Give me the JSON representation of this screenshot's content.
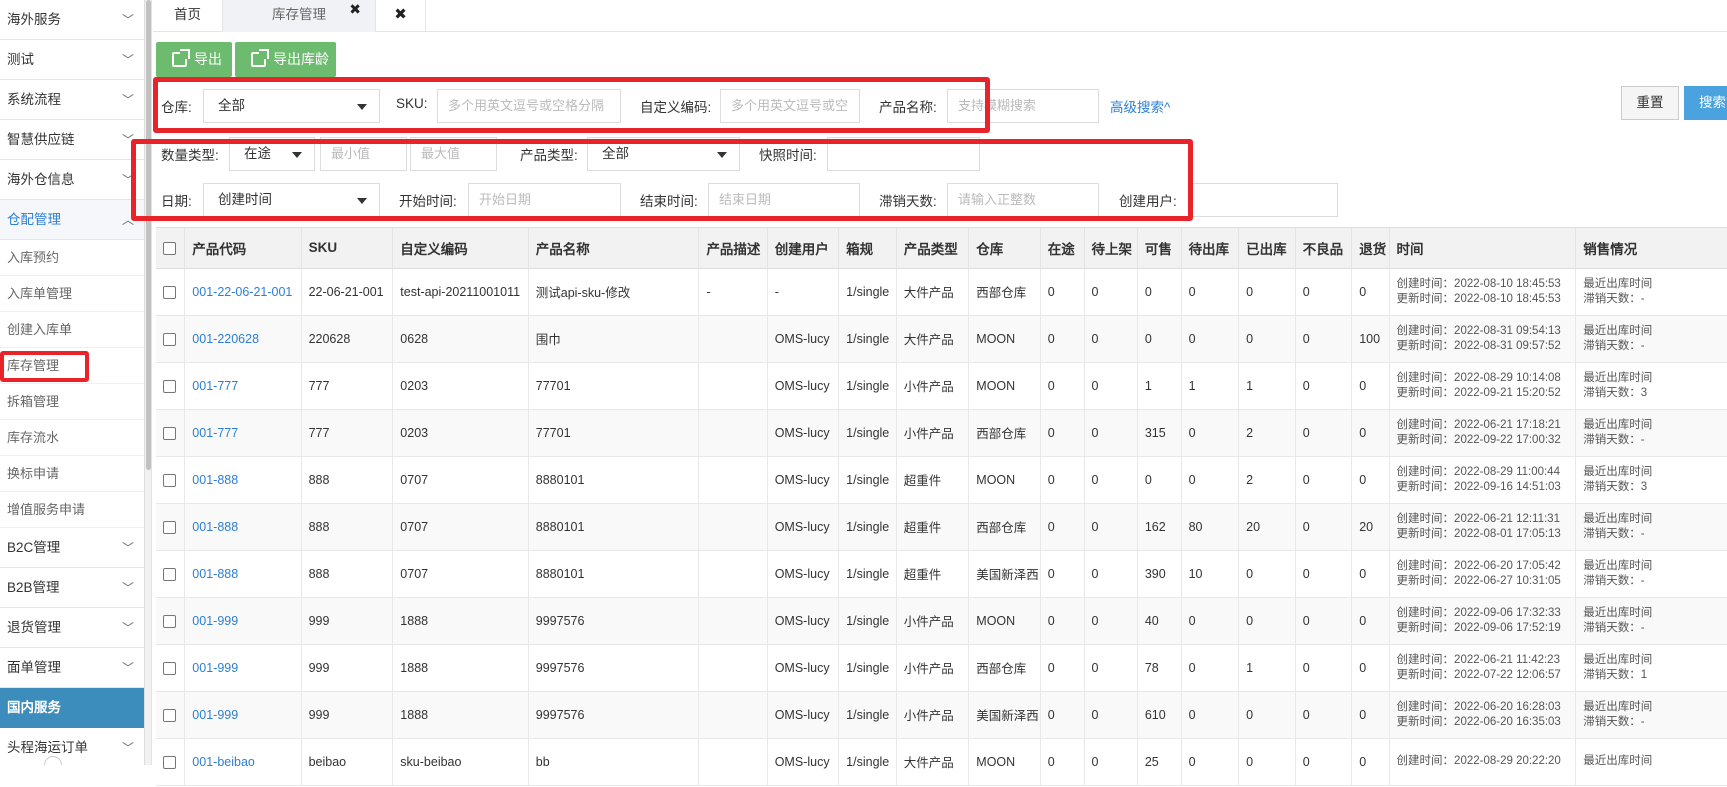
{
  "sidebar": {
    "items_top": [
      {
        "label": "海外服务"
      },
      {
        "label": "测试"
      },
      {
        "label": "系统流程"
      },
      {
        "label": "智慧供应链"
      },
      {
        "label": "海外仓信息"
      }
    ],
    "open_group": {
      "label": "仓配管理"
    },
    "sub_items": [
      {
        "label": "入库预约"
      },
      {
        "label": "入库单管理"
      },
      {
        "label": "创建入库单"
      },
      {
        "label": "库存管理"
      },
      {
        "label": "拆箱管理"
      },
      {
        "label": "库存流水"
      },
      {
        "label": "换标申请"
      },
      {
        "label": "增值服务申请"
      }
    ],
    "items_bottom": [
      {
        "label": "B2C管理"
      },
      {
        "label": "B2B管理"
      },
      {
        "label": "退货管理"
      },
      {
        "label": "面单管理"
      }
    ],
    "dark_item": {
      "label": "国内服务"
    },
    "last_item": {
      "label": "头程海运订单"
    }
  },
  "tabs": {
    "home": "首页",
    "active": "库存管理",
    "close_symbol": "✖",
    "active_close": "✖"
  },
  "toolbar": {
    "export": "导出",
    "export_age": "导出库龄"
  },
  "filters": {
    "warehouse_label": "仓库:",
    "warehouse_value": "全部",
    "sku_label": "SKU:",
    "sku_placeholder": "多个用英文逗号或空格分隔",
    "custom_code_label": "自定义编码:",
    "custom_code_placeholder": "多个用英文逗号或空",
    "product_name_label": "产品名称:",
    "product_name_placeholder": "支持模糊搜索",
    "advanced_search": "高级搜索^",
    "reset": "重置",
    "search": "搜索",
    "qty_type_label": "数量类型:",
    "qty_type_value": "在途",
    "min_placeholder": "最小值",
    "max_placeholder": "最大值",
    "product_type_label": "产品类型:",
    "product_type_value": "全部",
    "snapshot_label": "快照时间:",
    "date_label": "日期:",
    "date_value": "创建时间",
    "start_label": "开始时间:",
    "start_placeholder": "开始日期",
    "end_label": "结束时间:",
    "end_placeholder": "结束日期",
    "stale_days_label": "滞销天数:",
    "stale_days_placeholder": "请输入正整数",
    "creator_label": "创建用户:"
  },
  "table": {
    "headers": [
      "产品代码",
      "SKU",
      "自定义编码",
      "产品名称",
      "产品描述",
      "创建用户",
      "箱规",
      "产品类型",
      "仓库",
      "在途",
      "待上架",
      "可售",
      "待出库",
      "已出库",
      "不良品",
      "退货",
      "时间",
      "销售情况"
    ],
    "rows": [
      {
        "code": "001-22-06-21-001",
        "sku": "22-06-21-001",
        "custom": "test-api-20211001011",
        "name": "测试api-sku-修改",
        "desc": "-",
        "creator": "-",
        "box": "1/single",
        "ptype": "大件产品",
        "wh": "西部仓库",
        "transit": "0",
        "pending": "0",
        "sellable": "0",
        "out_pending": "0",
        "shipped": "0",
        "defect": "0",
        "returned": "0",
        "created": "创建时间：2022-08-10 18:45:53",
        "updated": "更新时间：2022-08-10 18:45:53",
        "sale1": "最近出库时间",
        "sale2": "滞销天数：-"
      },
      {
        "code": "001-220628",
        "sku": "220628",
        "custom": "0628",
        "name": "围巾",
        "desc": "",
        "creator": "OMS-lucy",
        "box": "1/single",
        "ptype": "大件产品",
        "wh": "MOON",
        "transit": "0",
        "pending": "0",
        "sellable": "0",
        "out_pending": "0",
        "shipped": "0",
        "defect": "0",
        "returned": "100",
        "created": "创建时间：2022-08-31 09:54:13",
        "updated": "更新时间：2022-08-31 09:57:52",
        "sale1": "最近出库时间",
        "sale2": "滞销天数：-"
      },
      {
        "code": "001-777",
        "sku": "777",
        "custom": "0203",
        "name": "77701",
        "desc": "",
        "creator": "OMS-lucy",
        "box": "1/single",
        "ptype": "小件产品",
        "wh": "MOON",
        "transit": "0",
        "pending": "0",
        "sellable": "1",
        "out_pending": "1",
        "shipped": "1",
        "defect": "0",
        "returned": "0",
        "created": "创建时间：2022-08-29 10:14:08",
        "updated": "更新时间：2022-09-21 15:20:52",
        "sale1": "最近出库时间",
        "sale2": "滞销天数：3"
      },
      {
        "code": "001-777",
        "sku": "777",
        "custom": "0203",
        "name": "77701",
        "desc": "",
        "creator": "OMS-lucy",
        "box": "1/single",
        "ptype": "小件产品",
        "wh": "西部仓库",
        "transit": "0",
        "pending": "0",
        "sellable": "315",
        "out_pending": "0",
        "shipped": "2",
        "defect": "0",
        "returned": "0",
        "created": "创建时间：2022-06-21 17:18:21",
        "updated": "更新时间：2022-09-22 17:00:32",
        "sale1": "最近出库时间",
        "sale2": "滞销天数：-"
      },
      {
        "code": "001-888",
        "sku": "888",
        "custom": "0707",
        "name": "8880101",
        "desc": "",
        "creator": "OMS-lucy",
        "box": "1/single",
        "ptype": "超重件",
        "wh": "MOON",
        "transit": "0",
        "pending": "0",
        "sellable": "0",
        "out_pending": "0",
        "shipped": "2",
        "defect": "0",
        "returned": "0",
        "created": "创建时间：2022-08-29 11:00:44",
        "updated": "更新时间：2022-09-16 14:51:03",
        "sale1": "最近出库时间",
        "sale2": "滞销天数：3"
      },
      {
        "code": "001-888",
        "sku": "888",
        "custom": "0707",
        "name": "8880101",
        "desc": "",
        "creator": "OMS-lucy",
        "box": "1/single",
        "ptype": "超重件",
        "wh": "西部仓库",
        "transit": "0",
        "pending": "0",
        "sellable": "162",
        "out_pending": "80",
        "shipped": "20",
        "defect": "0",
        "returned": "20",
        "created": "创建时间：2022-06-21 12:11:31",
        "updated": "更新时间：2022-08-01 17:05:13",
        "sale1": "最近出库时间",
        "sale2": "滞销天数：-"
      },
      {
        "code": "001-888",
        "sku": "888",
        "custom": "0707",
        "name": "8880101",
        "desc": "",
        "creator": "OMS-lucy",
        "box": "1/single",
        "ptype": "超重件",
        "wh": "美国新泽西",
        "transit": "0",
        "pending": "0",
        "sellable": "390",
        "out_pending": "10",
        "shipped": "0",
        "defect": "0",
        "returned": "0",
        "created": "创建时间：2022-06-20 17:05:42",
        "updated": "更新时间：2022-06-27 10:31:05",
        "sale1": "最近出库时间",
        "sale2": "滞销天数：-"
      },
      {
        "code": "001-999",
        "sku": "999",
        "custom": "1888",
        "name": "9997576",
        "desc": "",
        "creator": "OMS-lucy",
        "box": "1/single",
        "ptype": "小件产品",
        "wh": "MOON",
        "transit": "0",
        "pending": "0",
        "sellable": "40",
        "out_pending": "0",
        "shipped": "0",
        "defect": "0",
        "returned": "0",
        "created": "创建时间：2022-09-06 17:32:33",
        "updated": "更新时间：2022-09-06 17:52:19",
        "sale1": "最近出库时间",
        "sale2": "滞销天数：-"
      },
      {
        "code": "001-999",
        "sku": "999",
        "custom": "1888",
        "name": "9997576",
        "desc": "",
        "creator": "OMS-lucy",
        "box": "1/single",
        "ptype": "小件产品",
        "wh": "西部仓库",
        "transit": "0",
        "pending": "0",
        "sellable": "78",
        "out_pending": "0",
        "shipped": "1",
        "defect": "0",
        "returned": "0",
        "created": "创建时间：2022-06-21 11:42:23",
        "updated": "更新时间：2022-07-22 12:06:57",
        "sale1": "最近出库时间",
        "sale2": "滞销天数：1"
      },
      {
        "code": "001-999",
        "sku": "999",
        "custom": "1888",
        "name": "9997576",
        "desc": "",
        "creator": "OMS-lucy",
        "box": "1/single",
        "ptype": "小件产品",
        "wh": "美国新泽西",
        "transit": "0",
        "pending": "0",
        "sellable": "610",
        "out_pending": "0",
        "shipped": "0",
        "defect": "0",
        "returned": "0",
        "created": "创建时间：2022-06-20 16:28:03",
        "updated": "更新时间：2022-06-20 16:35:03",
        "sale1": "最近出库时间",
        "sale2": "滞销天数：-"
      },
      {
        "code": "001-beibao",
        "sku": "beibao",
        "custom": "sku-beibao",
        "name": "bb",
        "desc": "",
        "creator": "OMS-lucy",
        "box": "1/single",
        "ptype": "大件产品",
        "wh": "MOON",
        "transit": "0",
        "pending": "0",
        "sellable": "25",
        "out_pending": "0",
        "shipped": "0",
        "defect": "0",
        "returned": "0",
        "created": "创建时间：2022-08-29 20:22:20",
        "updated": "",
        "sale1": "最近出库时间",
        "sale2": ""
      }
    ]
  }
}
